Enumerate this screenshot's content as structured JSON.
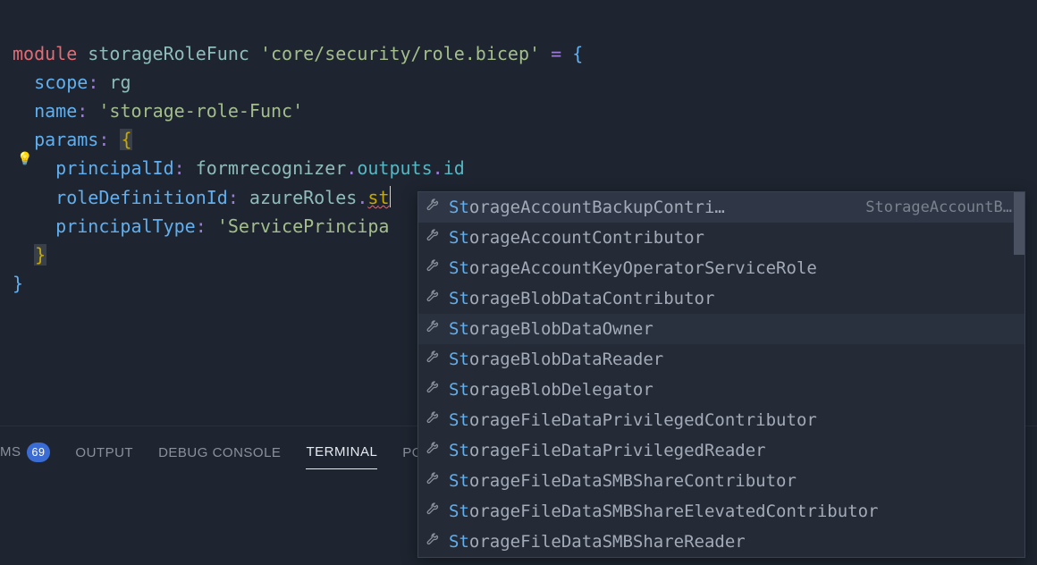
{
  "colors": {
    "accent": "#61afef",
    "keyword": "#e06c75",
    "string": "#a3be8c",
    "identifier": "#8fbcbb",
    "property": "#61afef",
    "member": "#56b6c2",
    "punct": "#9d7cd8",
    "typed": "#c5a900",
    "editorBg": "#1e2530",
    "suggestBg": "#242b37",
    "suggestSelected": "#2f3746",
    "muted": "#8a919c",
    "badgeBg": "#3b6cd4"
  },
  "code": {
    "line1": {
      "module": "module",
      "name": "storageRoleFunc",
      "path": "'core/security/role.bicep'",
      "eq": "=",
      "brace": "{"
    },
    "line2": {
      "prop": "scope",
      "colon": ":",
      "value": "rg"
    },
    "line3": {
      "prop": "name",
      "colon": ":",
      "value": "'storage-role-Func'"
    },
    "line4": {
      "prop": "params",
      "colon": ":",
      "brace": "{"
    },
    "line5": {
      "prop": "principalId",
      "colon": ":",
      "obj": "formrecognizer",
      "dot1": ".",
      "m1": "outputs",
      "dot2": ".",
      "m2": "id"
    },
    "line6": {
      "prop": "roleDefinitionId",
      "colon": ":",
      "obj": "azureRoles",
      "dot": ".",
      "typedPrefix": "s",
      "typedRest": "t"
    },
    "line7": {
      "prop": "principalType",
      "colon": ":",
      "value": "'ServicePrincipa"
    },
    "line8": {
      "brace": "}"
    },
    "line9": {
      "brace": "}"
    }
  },
  "bulbIconName": "lightbulb-icon",
  "panel": {
    "tabs": [
      {
        "label": "MS",
        "badge": "69",
        "active": false,
        "cut": true
      },
      {
        "label": "OUTPUT",
        "active": false
      },
      {
        "label": "DEBUG CONSOLE",
        "active": false
      },
      {
        "label": "TERMINAL",
        "active": true
      },
      {
        "label": "PO",
        "active": false,
        "cut": true
      }
    ]
  },
  "suggest": {
    "matchPrefix": "St",
    "selectedIndex": 0,
    "hoverIndex": 4,
    "detailText": "StorageAccountB…",
    "items": [
      {
        "label": "StorageAccountBackupContri…"
      },
      {
        "label": "StorageAccountContributor"
      },
      {
        "label": "StorageAccountKeyOperatorServiceRole"
      },
      {
        "label": "StorageBlobDataContributor"
      },
      {
        "label": "StorageBlobDataOwner"
      },
      {
        "label": "StorageBlobDataReader"
      },
      {
        "label": "StorageBlobDelegator"
      },
      {
        "label": "StorageFileDataPrivilegedContributor"
      },
      {
        "label": "StorageFileDataPrivilegedReader"
      },
      {
        "label": "StorageFileDataSMBShareContributor"
      },
      {
        "label": "StorageFileDataSMBShareElevatedContributor"
      },
      {
        "label": "StorageFileDataSMBShareReader"
      }
    ],
    "scrollbar": {
      "thumbHeightPx": 70
    }
  }
}
